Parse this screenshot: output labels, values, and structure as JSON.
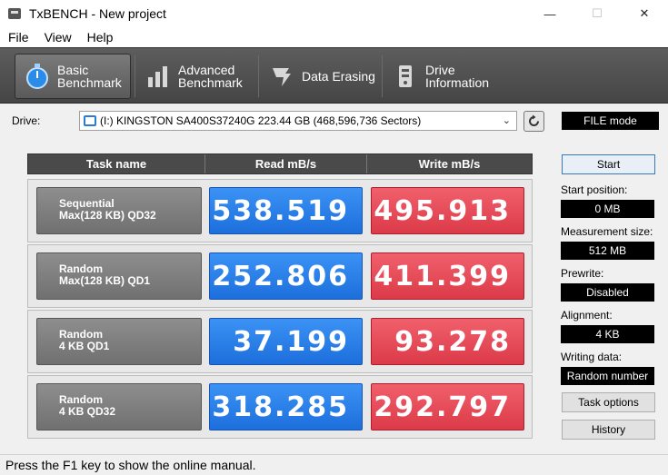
{
  "window": {
    "title": "TxBENCH - New project",
    "minimize": "—",
    "maximize": "☐",
    "close": "✕"
  },
  "menu": [
    "File",
    "View",
    "Help"
  ],
  "toolbar": [
    {
      "label1": "Basic",
      "label2": "Benchmark",
      "icon": "stopwatch-icon",
      "active": true
    },
    {
      "label1": "Advanced",
      "label2": "Benchmark",
      "icon": "bar-chart-icon",
      "active": false
    },
    {
      "label1": "Data Erasing",
      "label2": "",
      "icon": "eraser-icon",
      "active": false
    },
    {
      "label1": "Drive",
      "label2": "Information",
      "icon": "drive-info-icon",
      "active": false
    }
  ],
  "drive": {
    "label": "Drive:",
    "selected": "(I:) KINGSTON SA400S37240G  223.44 GB (468,596,736 Sectors)",
    "mode": "FILE mode"
  },
  "table": {
    "headers": [
      "Task name",
      "Read mB/s",
      "Write mB/s"
    ],
    "rows": [
      {
        "line1": "Sequential",
        "line2": "Max(128 KB) QD32",
        "read": "538.519",
        "write": "495.913"
      },
      {
        "line1": "Random",
        "line2": "Max(128 KB) QD1",
        "read": "252.806",
        "write": "411.399"
      },
      {
        "line1": "Random",
        "line2": "4 KB QD1",
        "read": "37.199",
        "write": "93.278"
      },
      {
        "line1": "Random",
        "line2": "4 KB QD32",
        "read": "318.285",
        "write": "292.797"
      }
    ]
  },
  "side": {
    "start": "Start",
    "start_position_label": "Start position:",
    "start_position": "0 MB",
    "measurement_size_label": "Measurement size:",
    "measurement_size": "512 MB",
    "prewrite_label": "Prewrite:",
    "prewrite": "Disabled",
    "alignment_label": "Alignment:",
    "alignment": "4 KB",
    "writing_data_label": "Writing data:",
    "writing_data": "Random number",
    "task_options": "Task options",
    "history": "History"
  },
  "status": "Press the F1 key to show the online manual."
}
